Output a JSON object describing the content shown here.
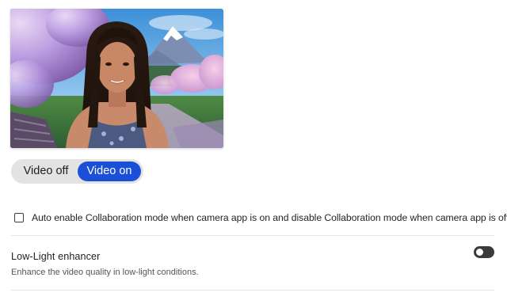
{
  "preview": {
    "image": "camera-preview-woman-cherry-blossom-background"
  },
  "video_toggle": {
    "off_label": "Video off",
    "on_label": "Video on",
    "selected": "on",
    "accent_color": "#1b4fd8"
  },
  "collaboration": {
    "checked": false,
    "label": "Auto enable Collaboration mode when camera app is on and disable Collaboration mode when camera app is off."
  },
  "low_light": {
    "title": "Low-Light enhancer",
    "description": "Enhance the video quality in low-light conditions.",
    "enabled": false
  }
}
